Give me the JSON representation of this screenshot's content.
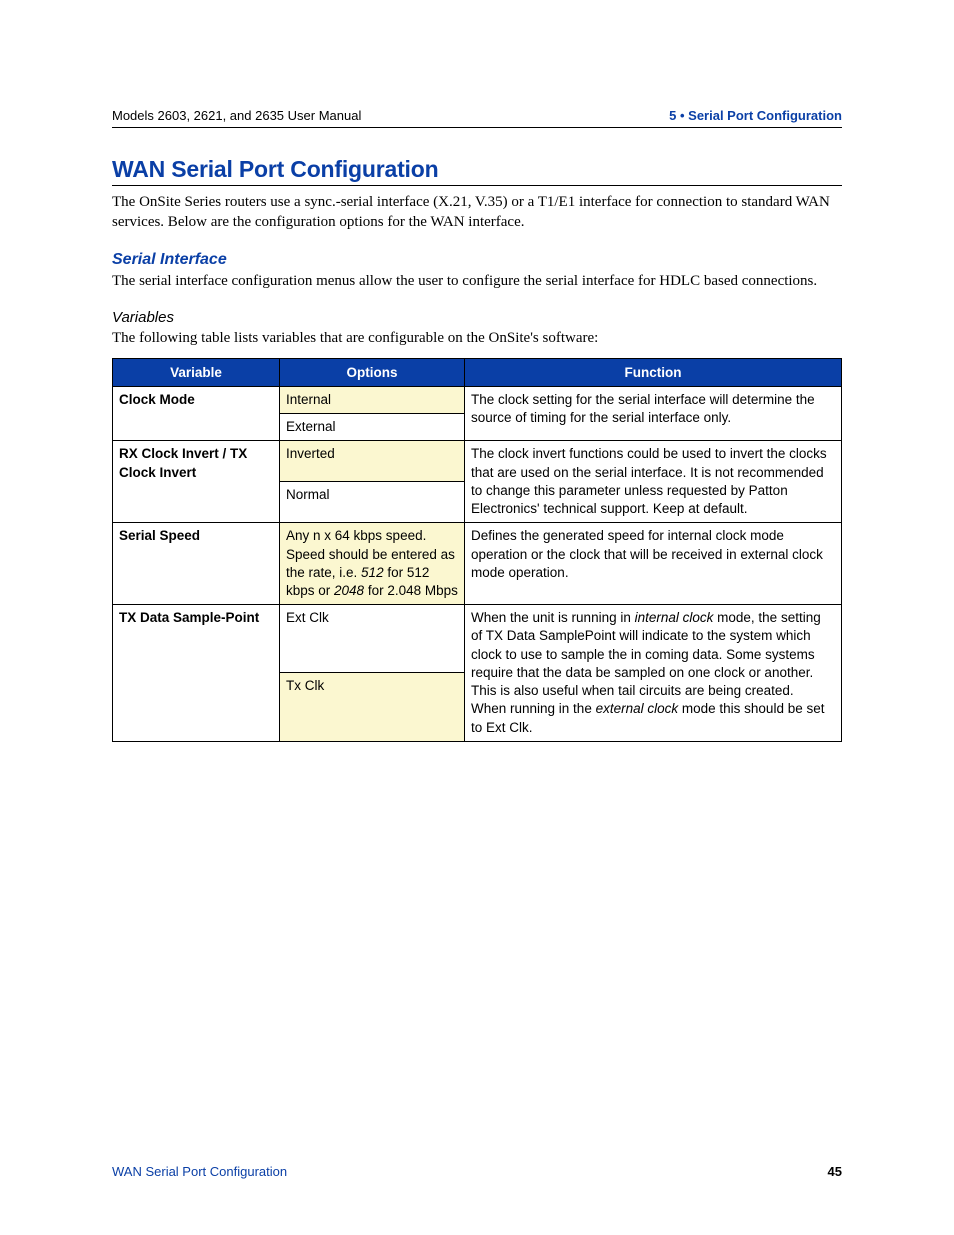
{
  "header": {
    "left": "Models 2603, 2621, and 2635 User Manual",
    "right": "5 • Serial Port Configuration"
  },
  "title": "WAN Serial Port Configuration",
  "intro": "The OnSite Series routers use a sync.-serial interface (X.21, V.35) or a T1/E1 interface for connection to standard WAN services. Below are the configuration options for the WAN interface.",
  "sub_title": "Serial Interface",
  "sub_intro": "The serial interface configuration menus allow the user to configure the serial interface for HDLC based connections.",
  "vars_heading": "Variables",
  "vars_intro": "The following table lists variables that are configurable on the OnSite's software:",
  "table": {
    "headers": [
      "Variable",
      "Options",
      "Function"
    ],
    "rows": [
      {
        "variable": "Clock Mode",
        "options": [
          "Internal",
          "External"
        ],
        "function": "The clock setting for the serial interface will determine the source of timing for the serial interface only."
      },
      {
        "variable": "RX Clock Invert / TX Clock Invert",
        "options": [
          "Inverted",
          "Normal"
        ],
        "function": "The clock invert functions could be used to invert the clocks that are used on the serial interface. It is not recommended to change this parameter unless requested by Patton Electronics' technical support. Keep at default."
      },
      {
        "variable": "Serial Speed",
        "options_rich": {
          "pre": "Any n x 64 kbps speed. Speed should be entered as the rate, i.e. ",
          "i1": "512",
          "mid": " for 512 kbps or ",
          "i2": "2048",
          "post": " for 2.048 Mbps"
        },
        "function": "Defines the generated speed for internal clock mode operation or the clock that will be received in external clock mode operation."
      },
      {
        "variable": "TX Data Sample-Point",
        "options": [
          "Ext Clk",
          "Tx Clk"
        ],
        "function_rich": {
          "p1a": "When the unit is running in ",
          "p1i": "internal clock",
          "p1b": " mode, the setting of TX Data SamplePoint will indicate to the system which clock to use to sample the in coming data. Some systems require that the data be sampled on one clock or another. This is also useful when tail circuits are being created.",
          "p2a": "When running in the ",
          "p2i": "external clock",
          "p2b": " mode this should be set to Ext Clk."
        }
      }
    ]
  },
  "footer": {
    "left": "WAN Serial Port Configuration",
    "page": "45"
  }
}
